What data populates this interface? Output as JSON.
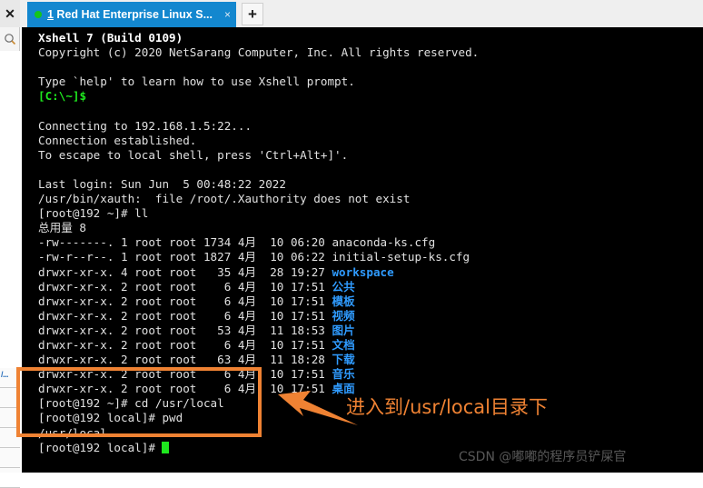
{
  "sidebar": {
    "close_label": "✕",
    "search_icon": "search-icon",
    "fragment_text": "/..."
  },
  "tabbar": {
    "tab": {
      "index": "1",
      "title": " Red Hat Enterprise Linux S...",
      "close_label": "×",
      "status_color": "#14c51b",
      "active_color": "#1387cf"
    },
    "new_tab_label": "+"
  },
  "terminal": {
    "lines": [
      {
        "text": "Xshell 7 (Build 0109)",
        "style": "bold"
      },
      {
        "text": "Copyright (c) 2020 NetSarang Computer, Inc. All rights reserved.",
        "style": "white"
      },
      {
        "text": "",
        "style": "white"
      },
      {
        "text": "Type `help' to learn how to use Xshell prompt.",
        "style": "white"
      },
      {
        "text": "[C:\\~]$",
        "style": "green"
      },
      {
        "text": "",
        "style": "white"
      },
      {
        "text": "Connecting to 192.168.1.5:22...",
        "style": "white"
      },
      {
        "text": "Connection established.",
        "style": "white"
      },
      {
        "text": "To escape to local shell, press 'Ctrl+Alt+]'.",
        "style": "white"
      },
      {
        "text": "",
        "style": "white"
      },
      {
        "text": "Last login: Sun Jun  5 00:48:22 2022",
        "style": "white"
      },
      {
        "text": "/usr/bin/xauth:  file /root/.Xauthority does not exist",
        "style": "white"
      },
      {
        "text": "[root@192 ~]# ll",
        "style": "white"
      },
      {
        "text": "总用量 8",
        "style": "white"
      },
      {
        "text": "-rw-------. 1 root root 1734 4月  10 06:20 anaconda-ks.cfg",
        "style": "white"
      },
      {
        "text": "-rw-r--r--. 1 root root 1827 4月  10 06:22 initial-setup-ks.cfg",
        "style": "white"
      },
      {
        "text": "drwxr-xr-x. 4 root root   35 4月  28 19:27 ",
        "suffix": "workspace",
        "style": "white",
        "suffix_style": "blue"
      },
      {
        "text": "drwxr-xr-x. 2 root root    6 4月  10 17:51 ",
        "suffix": "公共",
        "style": "white",
        "suffix_style": "blue"
      },
      {
        "text": "drwxr-xr-x. 2 root root    6 4月  10 17:51 ",
        "suffix": "模板",
        "style": "white",
        "suffix_style": "blue"
      },
      {
        "text": "drwxr-xr-x. 2 root root    6 4月  10 17:51 ",
        "suffix": "视频",
        "style": "white",
        "suffix_style": "blue"
      },
      {
        "text": "drwxr-xr-x. 2 root root   53 4月  11 18:53 ",
        "suffix": "图片",
        "style": "white",
        "suffix_style": "blue"
      },
      {
        "text": "drwxr-xr-x. 2 root root    6 4月  10 17:51 ",
        "suffix": "文档",
        "style": "white",
        "suffix_style": "blue"
      },
      {
        "text": "drwxr-xr-x. 2 root root   63 4月  11 18:28 ",
        "suffix": "下载",
        "style": "white",
        "suffix_style": "blue"
      },
      {
        "text": "drwxr-xr-x. 2 root root    6 4月  10 17:51 ",
        "suffix": "音乐",
        "style": "white",
        "suffix_style": "blue"
      },
      {
        "text": "drwxr-xr-x. 2 root root    6 4月  10 17:51 ",
        "suffix": "桌面",
        "style": "white",
        "suffix_style": "blue"
      },
      {
        "text": "[root@192 ~]# cd /usr/local",
        "style": "white"
      },
      {
        "text": "[root@192 local]# pwd",
        "style": "white"
      },
      {
        "text": "/usr/local",
        "style": "white"
      },
      {
        "text": "[root@192 local]# ",
        "style": "white",
        "cursor": true
      }
    ]
  },
  "annotation": {
    "text": "进入到/usr/local目录下",
    "color": "#ef8233",
    "highlight_color": "#ef8233"
  },
  "watermark": {
    "text": "CSDN @嘟嘟的程序员铲屎官"
  }
}
